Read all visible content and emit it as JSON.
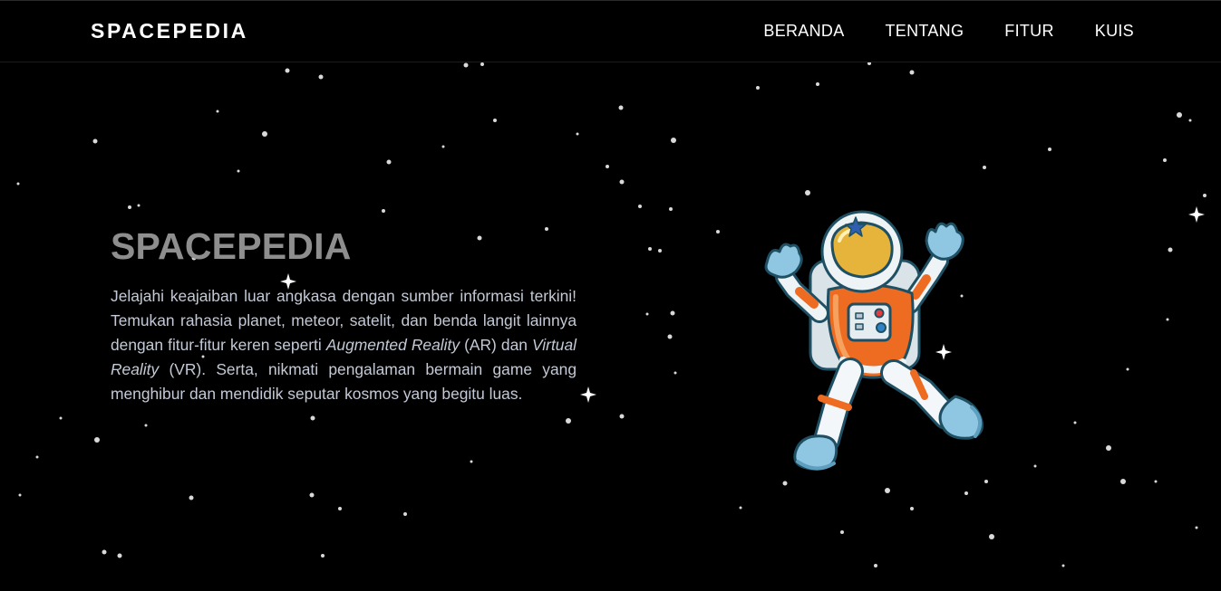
{
  "navbar": {
    "brand": "SPACEPEDIA",
    "links": [
      {
        "label": "BERANDA"
      },
      {
        "label": "TENTANG"
      },
      {
        "label": "FITUR"
      },
      {
        "label": "KUIS"
      }
    ]
  },
  "hero": {
    "title": "SPACEPEDIA",
    "text": {
      "part1": "Jelajahi keajaiban luar angkasa dengan sumber informasi terkini! Temukan rahasia planet, meteor, satelit, dan benda langit lainnya dengan fitur-fitur keren seperti ",
      "term_ar": "Augmented Reality",
      "part2": " (AR) dan ",
      "term_vr": "Virtual Reality",
      "part3": " (VR). Serta, nikmati pengalaman bermain game yang menghibur dan mendidik seputar kosmos yang begitu luas."
    }
  },
  "illustration": {
    "icon": "astronaut-illustration",
    "suit_color": "#ee6b22",
    "visor_color": "#e6b43a"
  },
  "colors": {
    "background": "#000000",
    "title": "#8e8e8e",
    "body_text": "#c3c9d6",
    "nav_text": "#ffffff"
  }
}
